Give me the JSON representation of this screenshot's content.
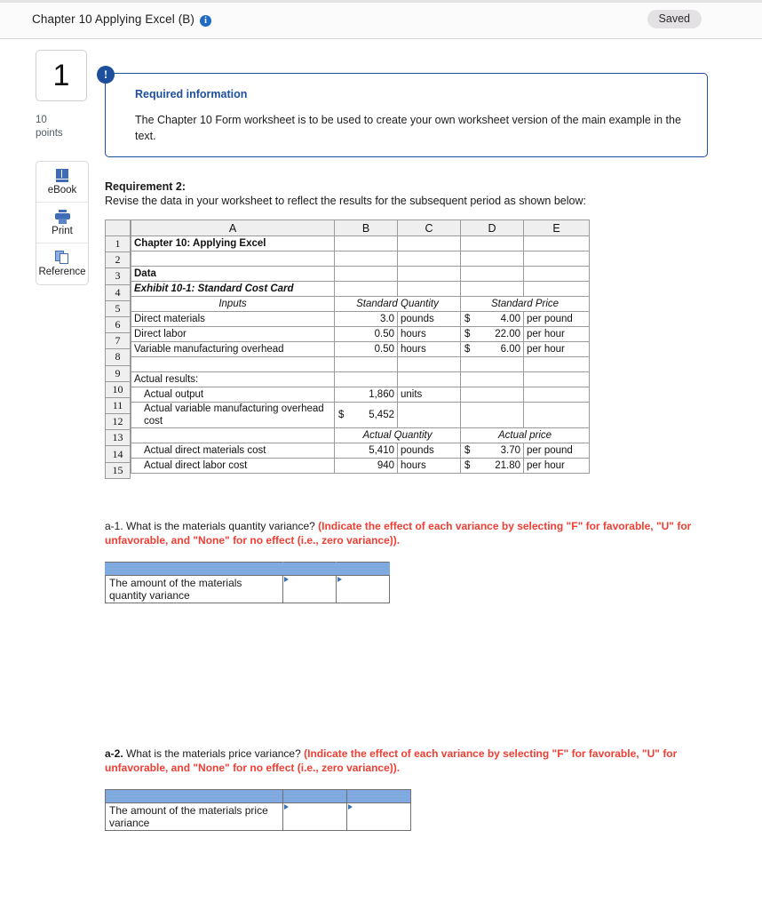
{
  "topbar": {
    "title": "Chapter 10 Applying Excel (B)",
    "info_icon": "info-icon",
    "info_glyph": "i",
    "saved_label": "Saved"
  },
  "rail": {
    "question_number": "1",
    "points_value": "10",
    "points_label": "points",
    "tools": [
      {
        "label": "eBook",
        "icon": "book-icon"
      },
      {
        "label": "Print",
        "icon": "printer-icon"
      },
      {
        "label": "Reference",
        "icon": "copy-icon"
      }
    ]
  },
  "required_info": {
    "badge_glyph": "!",
    "title": "Required information",
    "body": "The Chapter 10 Form worksheet is to be used to create your own worksheet version of the main example in the text."
  },
  "requirement": {
    "title": "Requirement 2:",
    "subtitle": "Revise the data in your worksheet to reflect the results for the subsequent period as shown below:"
  },
  "spreadsheet": {
    "column_headers": [
      "A",
      "B",
      "C",
      "D",
      "E"
    ],
    "row_numbers": [
      "1",
      "2",
      "3",
      "4",
      "5",
      "6",
      "7",
      "8",
      "9",
      "10",
      "11",
      "12",
      "13",
      "14",
      "15"
    ],
    "rows": [
      {
        "a": "Chapter 10: Applying Excel",
        "b": "",
        "c": "",
        "d": "",
        "e": ""
      },
      {
        "a": "",
        "b": "",
        "c": "",
        "d": "",
        "e": ""
      },
      {
        "a": "Data",
        "b": "",
        "c": "",
        "d": "",
        "e": ""
      },
      {
        "a": "Exhibit 10-1: Standard Cost Card",
        "b": "",
        "c": "",
        "d": "",
        "e": ""
      },
      {
        "a": "Inputs",
        "bc": "Standard Quantity",
        "de": "Standard Price"
      },
      {
        "a": "Direct materials",
        "b": "3.0",
        "c": "pounds",
        "d_sym": "$",
        "d": "4.00",
        "e": "per pound"
      },
      {
        "a": "Direct labor",
        "b": "0.50",
        "c": "hours",
        "d_sym": "$",
        "d": "22.00",
        "e": "per hour"
      },
      {
        "a": "Variable manufacturing overhead",
        "b": "0.50",
        "c": "hours",
        "d_sym": "$",
        "d": "6.00",
        "e": "per hour"
      },
      {
        "a": "",
        "b": "",
        "c": "",
        "d": "",
        "e": ""
      },
      {
        "a": "Actual results:",
        "b": "",
        "c": "",
        "d": "",
        "e": ""
      },
      {
        "a": "Actual output",
        "b": "1,860",
        "c": "units",
        "d": "",
        "e": ""
      },
      {
        "a": "Actual variable manufacturing overhead cost",
        "b_sym": "$",
        "b": "5,452",
        "c": "",
        "d": "",
        "e": ""
      },
      {
        "a": "",
        "bc": "Actual Quantity",
        "de": "Actual price"
      },
      {
        "a": "Actual direct materials cost",
        "b": "5,410",
        "c": "pounds",
        "d_sym": "$",
        "d": "3.70",
        "e": "per pound"
      },
      {
        "a": "Actual direct labor cost",
        "b": "940",
        "c": "hours",
        "d_sym": "$",
        "d": "21.80",
        "e": "per hour"
      }
    ]
  },
  "question_a1": {
    "lead": "a-1.",
    "prompt": " What is the materials quantity variance? ",
    "note": "(Indicate the effect of each variance by selecting \"F\" for favorable, \"U\" for unfavorable, and \"None\" for no effect (i.e., zero variance)).",
    "answer_table": {
      "header_cells": [
        "",
        "",
        ""
      ],
      "row_label": "The amount of the materials quantity variance",
      "value_cell": "",
      "effect_cell": ""
    }
  },
  "question_a2": {
    "lead": "a-2.",
    "prompt": " What is the materials price variance? ",
    "note": "(Indicate the effect of each variance by selecting \"F\" for favorable, \"U\" for unfavorable, and \"None\" for no effect (i.e., zero variance)).",
    "answer_table": {
      "header_cells": [
        "",
        "",
        ""
      ],
      "row_label": "The amount of the materials price variance",
      "value_cell": "",
      "effect_cell": ""
    }
  },
  "colors": {
    "accent_blue": "#1d4f9c",
    "header_blue": "#80a9df",
    "alert_red": "#ef3e33",
    "sheet_purple": "#7b52d8",
    "icon_blue": "#3f6cb5"
  }
}
